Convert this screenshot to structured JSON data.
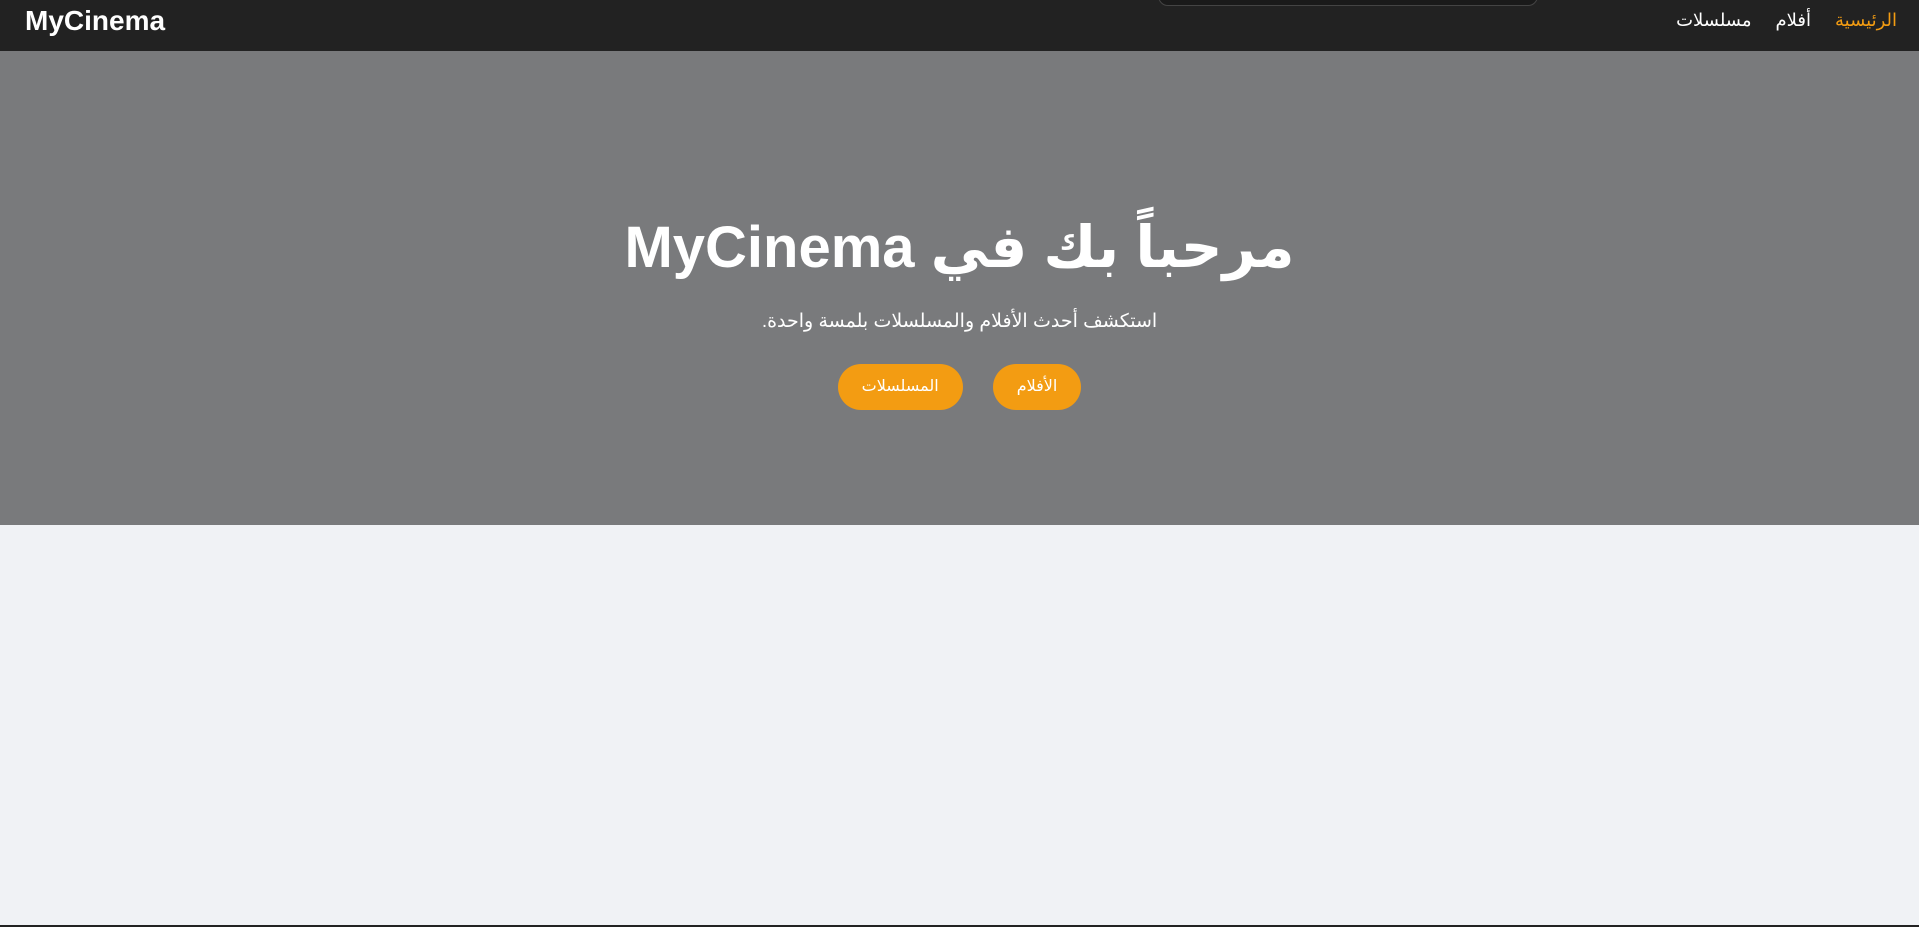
{
  "colors": {
    "navbar_bg": "#222222",
    "accent": "#f39c12",
    "hero_bg": "#797a7c",
    "page_bg": "#f0f2f5",
    "text_light": "#ffffff"
  },
  "navbar": {
    "brand": "MyCinema",
    "links": [
      {
        "label": "الرئيسية",
        "active": true
      },
      {
        "label": "أفلام",
        "active": false
      },
      {
        "label": "مسلسلات",
        "active": false
      }
    ]
  },
  "hero": {
    "title": "مرحباً بك في MyCinema",
    "subtitle": "استكشف أحدث الأفلام والمسلسلات بلمسة واحدة.",
    "buttons": {
      "movies": "الأفلام",
      "series": "المسلسلات"
    }
  }
}
